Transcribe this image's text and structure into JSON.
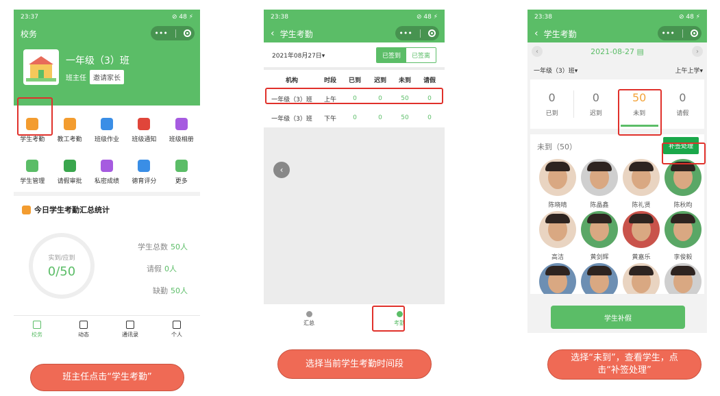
{
  "colors": {
    "brand_green": "#5bbd67",
    "highlight_red": "#e0302a",
    "caption_bg": "#ef6a55",
    "absent_orange": "#f3a33a"
  },
  "step1": {
    "statusbar": {
      "time": "23:37",
      "signal": "ᵢₗₗ ≋ HD",
      "right": "⊘ 48 ⚡"
    },
    "title": "校务",
    "class_name": "一年级（3）班",
    "teacher_label": "班主任",
    "invite_label": "邀请家长",
    "grid_items": [
      {
        "label": "学生考勤",
        "icon": "clock-icon",
        "color": "#f39c2f"
      },
      {
        "label": "教工考勤",
        "icon": "calendar-check-icon",
        "color": "#f39c2f"
      },
      {
        "label": "班级作业",
        "icon": "homework-icon",
        "color": "#3a8ee6"
      },
      {
        "label": "班级通知",
        "icon": "bell-icon",
        "color": "#e0453a"
      },
      {
        "label": "班级相册",
        "icon": "album-icon",
        "color": "#a65be0"
      },
      {
        "label": "学生管理",
        "icon": "student-icon",
        "color": "#5bbd67"
      },
      {
        "label": "请假审批",
        "icon": "approval-icon",
        "color": "#3aa64d"
      },
      {
        "label": "私密成绩",
        "icon": "grade-icon",
        "color": "#a65be0"
      },
      {
        "label": "德育评分",
        "icon": "medal-icon",
        "color": "#3a8ee6"
      },
      {
        "label": "更多",
        "icon": "more-grid-icon",
        "color": "#5bbd67"
      }
    ],
    "stats_title": "今日学生考勤汇总统计",
    "circle_label": "实到/应到",
    "circle_value": "0/50",
    "stat_rows": [
      {
        "label": "学生总数",
        "value": "50人"
      },
      {
        "label": "请假",
        "value": "0人"
      },
      {
        "label": "缺勤",
        "value": "50人"
      }
    ],
    "tabs": [
      {
        "label": "校务",
        "icon": "school-icon",
        "active": true
      },
      {
        "label": "动态",
        "icon": "message-icon",
        "active": false
      },
      {
        "label": "通讯录",
        "icon": "contacts-icon",
        "active": false
      },
      {
        "label": "个人",
        "icon": "user-icon",
        "active": false
      }
    ],
    "caption": "班主任点击“学生考勤”"
  },
  "step2": {
    "statusbar": {
      "time": "23:38",
      "signal": "ᵢₗₗ ≋ HD",
      "right": "⊘ 48 ⚡"
    },
    "back": "‹",
    "title": "学生考勤",
    "date": "2021年08月27日▾",
    "seg_on": "已签到",
    "seg_off": "已签离",
    "headers": [
      "机构",
      "时段",
      "已到",
      "迟到",
      "未到",
      "请假"
    ],
    "rows": [
      [
        "一年级（3）班",
        "上午",
        "0",
        "0",
        "50",
        "0"
      ],
      [
        "一年级（3）班",
        "下午",
        "0",
        "0",
        "50",
        "0"
      ]
    ],
    "side_arrow": "‹",
    "tabs": [
      {
        "label": "汇总",
        "icon": "summary-icon",
        "active": false
      },
      {
        "label": "考勤",
        "icon": "location-icon",
        "active": true
      }
    ],
    "caption": "选择当前学生考勤时间段"
  },
  "step3": {
    "statusbar": {
      "time": "23:38",
      "signal": "ᵢₗₗ ≋ HD",
      "right": "⊘ 48 ⚡"
    },
    "back": "‹",
    "title": "学生考勤",
    "date": "2021-08-27 ▤",
    "prev": "‹",
    "next": "›",
    "class_filter": "一年级（3）班▾",
    "period_filter": "上午上学▾",
    "counts": [
      {
        "num": "0",
        "label": "已到"
      },
      {
        "num": "0",
        "label": "迟到"
      },
      {
        "num": "50",
        "label": "未到"
      },
      {
        "num": "0",
        "label": "请假"
      }
    ],
    "absent_title": "未到（50）",
    "fix_button": "补签处理",
    "students": [
      {
        "name": "陈晓晴",
        "bg": ""
      },
      {
        "name": "陈晶鑫",
        "bg": "bg-grey"
      },
      {
        "name": "陈礼贤",
        "bg": ""
      },
      {
        "name": "陈秋昀",
        "bg": "bg-green"
      },
      {
        "name": "高洁",
        "bg": ""
      },
      {
        "name": "黄剑辉",
        "bg": "bg-green"
      },
      {
        "name": "黄嘉乐",
        "bg": "bg-red"
      },
      {
        "name": "李俊毅",
        "bg": "bg-green"
      },
      {
        "name": "",
        "bg": "bg-blue"
      },
      {
        "name": "",
        "bg": "bg-blue"
      },
      {
        "name": "",
        "bg": ""
      },
      {
        "name": "",
        "bg": "bg-grey"
      }
    ],
    "bottom_button": "学生补假",
    "caption": "选择“未到”，查看学生，点击“补签处理”"
  }
}
